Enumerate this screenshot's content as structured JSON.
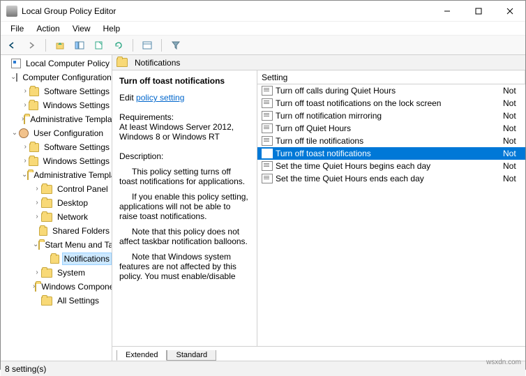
{
  "window": {
    "title": "Local Group Policy Editor"
  },
  "menu": {
    "file": "File",
    "action": "Action",
    "view": "View",
    "help": "Help"
  },
  "tree": {
    "root": "Local Computer Policy",
    "comp": "Computer Configuration",
    "comp_items": [
      "Software Settings",
      "Windows Settings",
      "Administrative Templates"
    ],
    "user": "User Configuration",
    "user_items": [
      "Software Settings",
      "Windows Settings"
    ],
    "admin": "Administrative Templates",
    "admin_items": [
      "Control Panel",
      "Desktop",
      "Network",
      "Shared Folders"
    ],
    "startmenu": "Start Menu and Taskbar",
    "notifications": "Notifications",
    "tail": [
      "System",
      "Windows Components",
      "All Settings"
    ]
  },
  "path": {
    "label": "Notifications"
  },
  "details": {
    "title": "Turn off toast notifications",
    "edit_prefix": "Edit ",
    "edit_link": "policy setting",
    "req_label": "Requirements:",
    "req_text": "At least Windows Server 2012, Windows 8 or Windows RT",
    "desc_label": "Description:",
    "p1": "This policy setting turns off toast notifications for applications.",
    "p2": "If you enable this policy setting, applications will not be able to raise toast notifications.",
    "p3": "Note that this policy does not affect taskbar notification balloons.",
    "p4": "Note that Windows system features are not affected by this policy.  You must enable/disable"
  },
  "list": {
    "col_setting": "Setting",
    "rows": [
      {
        "name": "Turn off calls during Quiet Hours",
        "state": "Not"
      },
      {
        "name": "Turn off toast notifications on the lock screen",
        "state": "Not"
      },
      {
        "name": "Turn off notification mirroring",
        "state": "Not"
      },
      {
        "name": "Turn off Quiet Hours",
        "state": "Not"
      },
      {
        "name": "Turn off tile notifications",
        "state": "Not"
      },
      {
        "name": "Turn off toast notifications",
        "state": "Not",
        "selected": true
      },
      {
        "name": "Set the time Quiet Hours begins each day",
        "state": "Not"
      },
      {
        "name": "Set the time Quiet Hours ends each day",
        "state": "Not"
      }
    ]
  },
  "tabs": {
    "extended": "Extended",
    "standard": "Standard"
  },
  "status": {
    "text": "8 setting(s)"
  },
  "watermark": "wsxdn.com"
}
